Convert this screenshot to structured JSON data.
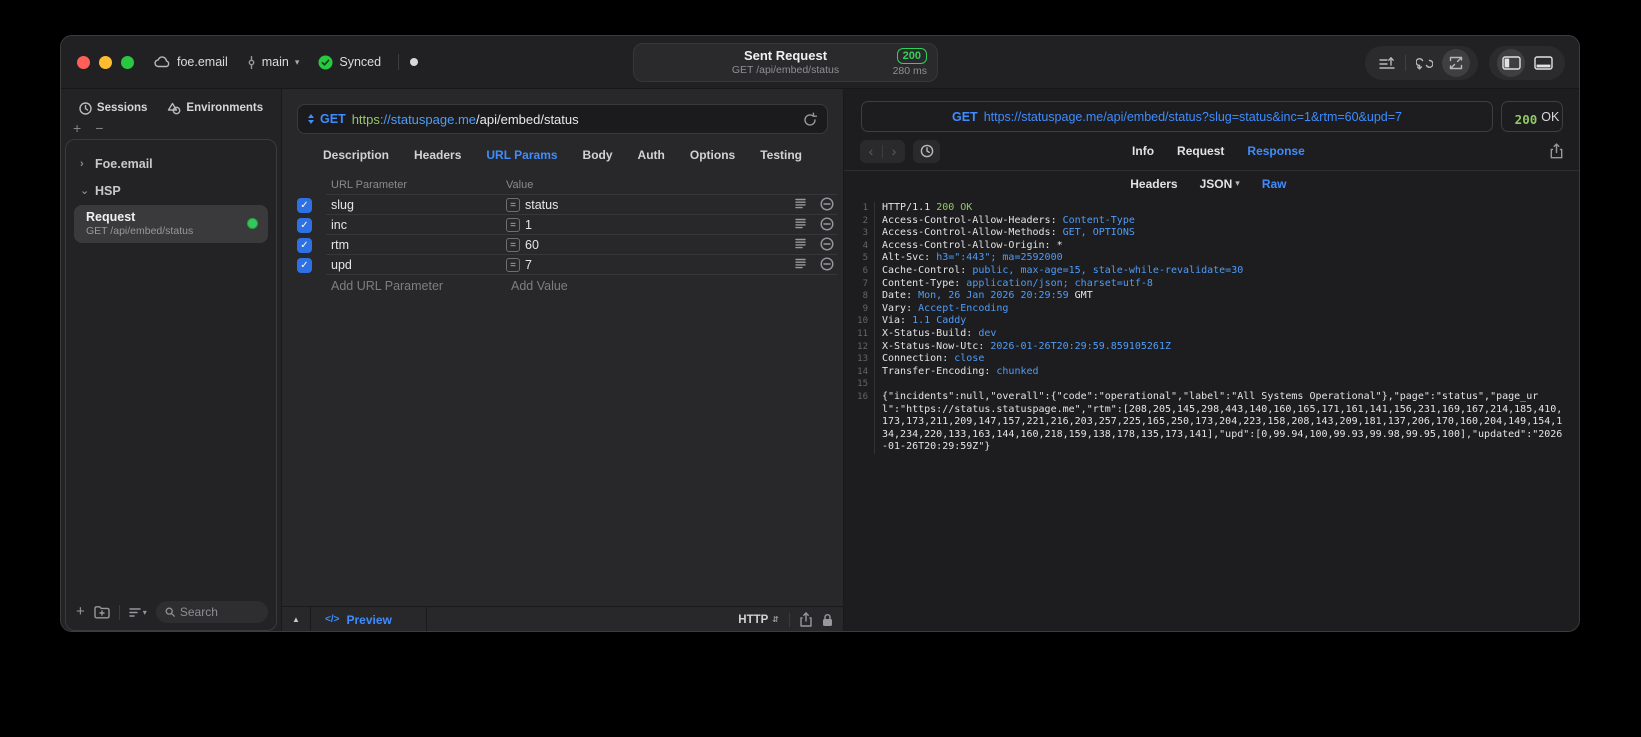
{
  "window": {
    "titlebar": {
      "project": "foe.email",
      "branch": "main",
      "sync_status": "Synced",
      "request_title": "Sent Request",
      "request_subtitle": "GET /api/embed/status",
      "status_code": "200",
      "duration": "280 ms"
    }
  },
  "sidebar": {
    "tabs": [
      {
        "label": "Sessions"
      },
      {
        "label": "Environments"
      }
    ],
    "tree": [
      {
        "label": "Foe.email",
        "state": "collapsed"
      },
      {
        "label": "HSP",
        "state": "expanded"
      }
    ],
    "selected_request": {
      "title": "Request",
      "subtitle": "GET /api/embed/status"
    },
    "search_placeholder": "Search"
  },
  "request_panel": {
    "method": "GET",
    "url_scheme": "https",
    "url_host": "://statuspage.me",
    "url_path": "/api/embed/status",
    "tabs": [
      "Description",
      "Headers",
      "URL Params",
      "Body",
      "Auth",
      "Options",
      "Testing"
    ],
    "active_tab": "URL Params",
    "param_table": {
      "col_name": "URL Parameter",
      "col_value": "Value",
      "rows": [
        {
          "name": "slug",
          "value": "status",
          "checked": true
        },
        {
          "name": "inc",
          "value": "1",
          "checked": true
        },
        {
          "name": "rtm",
          "value": "60",
          "checked": true
        },
        {
          "name": "upd",
          "value": "7",
          "checked": true
        }
      ],
      "add_name_placeholder": "Add URL Parameter",
      "add_value_placeholder": "Add Value"
    },
    "footer": {
      "preview_code": "</>",
      "preview_label": "Preview",
      "protocol": "HTTP"
    }
  },
  "response_panel": {
    "request_line": {
      "method": "GET",
      "url": "https://statuspage.me/api/embed/status?slug=status&inc=1&rtm=60&upd=7"
    },
    "status": {
      "code": "200",
      "text": "OK"
    },
    "tabs": [
      "Info",
      "Request",
      "Response"
    ],
    "active_tab": "Response",
    "view_tabs": [
      {
        "label": "Headers"
      },
      {
        "label": "JSON",
        "chevron": true
      },
      {
        "label": "Raw"
      }
    ],
    "active_view": "Raw",
    "lines": [
      {
        "n": "1",
        "parts": [
          {
            "t": "HTTP/1.1 ",
            "c": "w"
          },
          {
            "t": "200 OK",
            "c": "g"
          }
        ]
      },
      {
        "n": "2",
        "parts": [
          {
            "t": "Access-Control-Allow-Headers: ",
            "c": "w"
          },
          {
            "t": "Content-Type",
            "c": "b"
          }
        ]
      },
      {
        "n": "3",
        "parts": [
          {
            "t": "Access-Control-Allow-Methods: ",
            "c": "w"
          },
          {
            "t": "GET, OPTIONS",
            "c": "b"
          }
        ]
      },
      {
        "n": "4",
        "parts": [
          {
            "t": "Access-Control-Allow-Origin: ",
            "c": "w"
          },
          {
            "t": "*",
            "c": "w"
          }
        ]
      },
      {
        "n": "5",
        "parts": [
          {
            "t": "Alt-Svc: ",
            "c": "w"
          },
          {
            "t": "h3=\":443\"; ma=2592000",
            "c": "b"
          }
        ]
      },
      {
        "n": "6",
        "parts": [
          {
            "t": "Cache-Control: ",
            "c": "w"
          },
          {
            "t": "public, max-age=15, stale-while-revalidate=30",
            "c": "b"
          }
        ]
      },
      {
        "n": "7",
        "parts": [
          {
            "t": "Content-Type: ",
            "c": "w"
          },
          {
            "t": "application/json; charset=utf-8",
            "c": "b"
          }
        ]
      },
      {
        "n": "8",
        "parts": [
          {
            "t": "Date: ",
            "c": "w"
          },
          {
            "t": "Mon, 26 Jan 2026 20:29:59",
            "c": "b"
          },
          {
            "t": " GMT",
            "c": "w"
          }
        ]
      },
      {
        "n": "9",
        "parts": [
          {
            "t": "Vary: ",
            "c": "w"
          },
          {
            "t": "Accept-Encoding",
            "c": "b"
          }
        ]
      },
      {
        "n": "10",
        "parts": [
          {
            "t": "Via: ",
            "c": "w"
          },
          {
            "t": "1.1 Caddy",
            "c": "b"
          }
        ]
      },
      {
        "n": "11",
        "parts": [
          {
            "t": "X-Status-Build: ",
            "c": "w"
          },
          {
            "t": "dev",
            "c": "b"
          }
        ]
      },
      {
        "n": "12",
        "parts": [
          {
            "t": "X-Status-Now-Utc: ",
            "c": "w"
          },
          {
            "t": "2026-01-26T20:29:59.859105261Z",
            "c": "b"
          }
        ]
      },
      {
        "n": "13",
        "parts": [
          {
            "t": "Connection: ",
            "c": "w"
          },
          {
            "t": "close",
            "c": "b"
          }
        ]
      },
      {
        "n": "14",
        "parts": [
          {
            "t": "Transfer-Encoding: ",
            "c": "w"
          },
          {
            "t": "chunked",
            "c": "b"
          }
        ]
      },
      {
        "n": "15",
        "parts": []
      },
      {
        "n": "16",
        "parts": [
          {
            "t": "{\"incidents\":null,\"overall\":{\"code\":\"operational\",\"label\":\"All Systems Operational\"},\"page\":\"status\",\"page_url\":\"https://status.statuspage.me\",\"rtm\":[208,205,145,298,443,140,160,165,171,161,141,156,231,169,167,214,185,410,173,173,211,209,147,157,221,216,203,257,225,165,250,173,204,223,158,208,143,209,181,137,206,170,160,204,149,154,134,234,220,133,163,144,160,218,159,138,178,135,173,141],\"upd\":[0,99.94,100,99.93,99.98,99.95,100],\"updated\":\"2026-01-26T20:29:59Z\"}",
            "c": "w"
          }
        ]
      }
    ]
  },
  "icons": {
    "cloud": "sync project",
    "branch": "git branch",
    "check-circle": "synced ok",
    "clock": "sessions / history",
    "shapes": "environments",
    "magnifier": "search",
    "refresh": "resend request",
    "share": "export",
    "lock": "ssl lock",
    "panel-left": "toggle sidebar",
    "panel-bottom": "toggle bottom drawer"
  },
  "colors": {
    "accent_blue": "#3f8cfe",
    "code_blue": "#4f9cf8",
    "status_green": "#30d158",
    "code_green": "#8fc963",
    "url_scheme_green": "#97c56d",
    "window_bg": "#242426",
    "response_bg": "#1d1d1f"
  }
}
